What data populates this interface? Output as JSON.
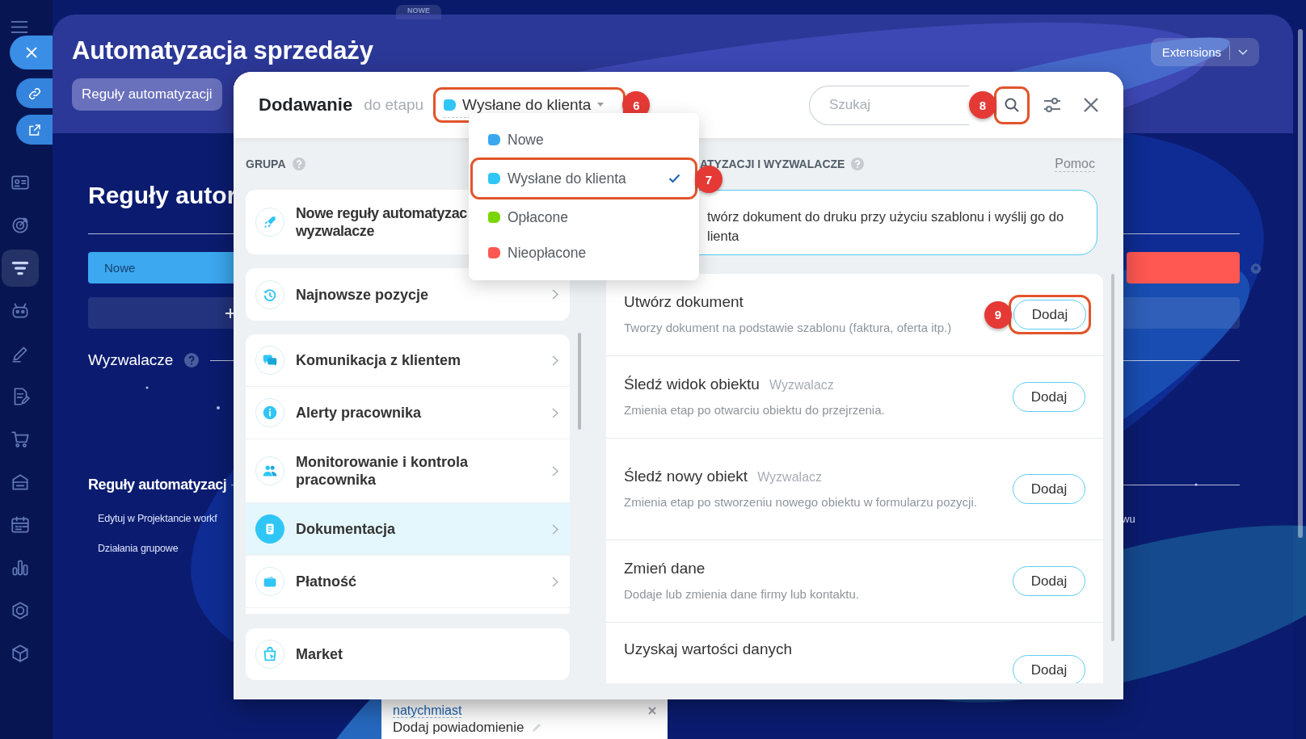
{
  "top_tab": {
    "label": "NOWE"
  },
  "sidebar": {
    "items": [
      {
        "selected": false
      },
      {
        "selected": false
      },
      {
        "selected": true
      },
      {
        "selected": false
      },
      {
        "selected": false
      },
      {
        "selected": false
      },
      {
        "selected": false
      },
      {
        "selected": false
      },
      {
        "selected": false
      },
      {
        "selected": false
      },
      {
        "selected": false
      },
      {
        "selected": false
      }
    ]
  },
  "page": {
    "title": "Automatyzacja sprzedaży",
    "tabs": [
      {
        "label": "Reguły automatyzacji",
        "selected": true
      }
    ],
    "extensions_button": "Extensions"
  },
  "background": {
    "heading": "Reguły autor",
    "stages": [
      {
        "label": "Nowe",
        "color": "#3ba8f0"
      },
      {
        "color": "#ff5752"
      }
    ],
    "triggers_label": "Wyzwalacze",
    "rules_label": "Reguły automatyzacj",
    "links": [
      "Edytuj w Projektancie workf",
      "Działania grupowe"
    ],
    "side_text": "wu"
  },
  "modal": {
    "title": "Dodawanie",
    "subtitle": "do etapu",
    "stage": {
      "label": "Wysłane do klienta",
      "color": "#2fc6f6",
      "callout": "6"
    },
    "search": {
      "placeholder": "Szukaj",
      "callout": "8"
    },
    "stage_menu": [
      {
        "label": "Nowe",
        "color": "#39a8ef",
        "selected": false
      },
      {
        "label": "Wysłane do klienta",
        "color": "#2fc6f6",
        "selected": true,
        "callout": "7"
      },
      {
        "label": "Opłacone",
        "color": "#7bd500",
        "selected": false
      },
      {
        "label": "Nieopłacone",
        "color": "#ff5752",
        "selected": false
      }
    ],
    "groups_heading": "GRUPA",
    "pinned_groups": [
      {
        "label": "Nowe reguły automatyzac wyzwalacze"
      },
      {
        "label": "Najnowsze pozycje"
      }
    ],
    "groups": [
      {
        "label": "Komunikacja z klientem",
        "selected": false
      },
      {
        "label": "Alerty pracownika",
        "selected": false
      },
      {
        "label": "Monitorowanie i kontrola pracownika",
        "selected": false
      },
      {
        "label": "Dokumentacja",
        "selected": true
      },
      {
        "label": "Płatność",
        "selected": false
      }
    ],
    "footer_group": {
      "label": "Market"
    },
    "actions_heading": "ATYZACJI I WYZWALACZE",
    "help_link": "Pomoc",
    "description": "twórz dokument do druku przy użyciu szablonu i wyślij go do lienta",
    "actions": [
      {
        "title": "Utwórz dokument",
        "description": "Tworzy dokument na podstawie szablonu (faktura, oferta itp.)",
        "button": "Dodaj",
        "callout": "9"
      },
      {
        "title": "Śledź widok obiektu",
        "tag": "Wyzwalacz",
        "description": "Zmienia etap po otwarciu obiektu do przejrzenia.",
        "button": "Dodaj"
      },
      {
        "title": "Śledź nowy obiekt",
        "tag": "Wyzwalacz",
        "description": "Zmienia etap po stworzeniu nowego obiektu w formularzu pozycji.",
        "button": "Dodaj"
      },
      {
        "title": "Zmień dane",
        "description": "Dodaje lub zmienia dane firmy lub kontaktu.",
        "button": "Dodaj"
      },
      {
        "title": "Uzyskaj wartości danych",
        "button": "Dodaj"
      }
    ]
  },
  "notification_card": {
    "link": "natychmiast",
    "label": "Dodaj powiadomienie"
  }
}
